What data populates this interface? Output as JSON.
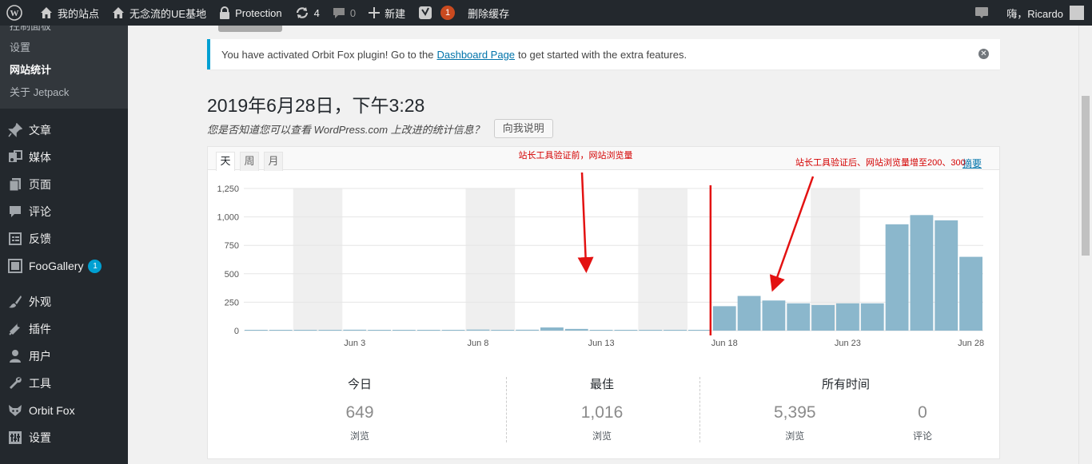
{
  "adminbar": {
    "site_name": "我的站点",
    "site2_name": "无念流的UE基地",
    "protection": "Protection",
    "updates_count": "4",
    "comments_count": "0",
    "new_label": "新建",
    "yoast_badge": "1",
    "clear_cache": "删除缓存",
    "greeting": "嗨，Ricardo"
  },
  "sidebar": {
    "submenu": [
      {
        "label": "控制面板"
      },
      {
        "label": "设置"
      },
      {
        "label": "网站统计"
      },
      {
        "label": "关于 Jetpack"
      }
    ],
    "items": [
      {
        "label": "文章",
        "icon": "pin-icon"
      },
      {
        "label": "媒体",
        "icon": "media-icon"
      },
      {
        "label": "页面",
        "icon": "page-icon"
      },
      {
        "label": "评论",
        "icon": "comment-icon"
      },
      {
        "label": "反馈",
        "icon": "feedback-icon"
      },
      {
        "label": "FooGallery",
        "icon": "gallery-icon",
        "count": "1"
      },
      {
        "label": "外观",
        "icon": "brush-icon"
      },
      {
        "label": "插件",
        "icon": "plugin-icon"
      },
      {
        "label": "用户",
        "icon": "user-icon"
      },
      {
        "label": "工具",
        "icon": "wrench-icon"
      },
      {
        "label": "Orbit Fox",
        "icon": "fox-icon"
      },
      {
        "label": "设置",
        "icon": "settings-icon"
      }
    ]
  },
  "notice": {
    "prefix": "You have activated Orbit Fox plugin! Go to the",
    "link": "Dashboard Page",
    "suffix": "to get started with the extra features."
  },
  "page": {
    "title": "2019年6月28日，下午3:28",
    "promo_text": "您是否知道您可以查看 WordPress.com 上改进的统计信息？",
    "promo_button": "向我说明"
  },
  "tabs": {
    "day": "天",
    "week": "周",
    "month": "月"
  },
  "summary_link": "摘要",
  "annotations": {
    "before": "站长工具验证前，网站浏览量",
    "after": "站长工具验证后、网站浏览量增至200、300"
  },
  "chart_data": {
    "type": "bar",
    "ylim": [
      0,
      1250
    ],
    "yticks": [
      "0",
      "250",
      "500",
      "750",
      "1,000",
      "1,250"
    ],
    "xtick_labels": [
      "Jun 3",
      "Jun 8",
      "Jun 13",
      "Jun 18",
      "Jun 23",
      "Jun 28"
    ],
    "categories": [
      "May 30",
      "May 31",
      "Jun 1",
      "Jun 2",
      "Jun 3",
      "Jun 4",
      "Jun 5",
      "Jun 6",
      "Jun 7",
      "Jun 8",
      "Jun 9",
      "Jun 10",
      "Jun 11",
      "Jun 12",
      "Jun 13",
      "Jun 14",
      "Jun 15",
      "Jun 16",
      "Jun 17",
      "Jun 18",
      "Jun 19",
      "Jun 20",
      "Jun 21",
      "Jun 22",
      "Jun 23",
      "Jun 24",
      "Jun 25",
      "Jun 26",
      "Jun 27",
      "Jun 28"
    ],
    "values": [
      2,
      5,
      3,
      6,
      8,
      4,
      7,
      2,
      3,
      9,
      5,
      8,
      28,
      15,
      6,
      4,
      7,
      2,
      3,
      215,
      305,
      265,
      240,
      225,
      240,
      240,
      935,
      1016,
      970,
      649
    ],
    "shaded_weekends": [
      [
        "Jun 1",
        "Jun 2"
      ],
      [
        "Jun 8",
        "Jun 9"
      ],
      [
        "Jun 15",
        "Jun 16"
      ],
      [
        "Jun 22",
        "Jun 23"
      ]
    ],
    "bar_color": "#8bb7cc",
    "marker_line_before": "Jun 18"
  },
  "stats": {
    "today": {
      "label": "今日",
      "value": "649",
      "unit": "浏览"
    },
    "best": {
      "label": "最佳",
      "value": "1,016",
      "unit": "浏览"
    },
    "alltime": {
      "label": "所有时间",
      "views": "5,395",
      "views_unit": "浏览",
      "comments": "0",
      "comments_unit": "评论"
    }
  }
}
